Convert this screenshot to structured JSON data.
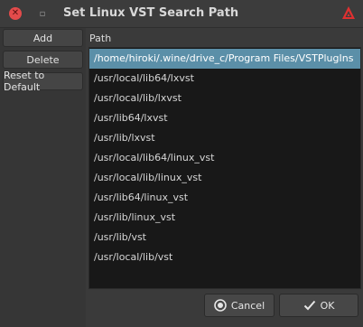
{
  "window": {
    "title": "Set Linux VST Search Path"
  },
  "sidebar": {
    "add_label": "Add",
    "delete_label": "Delete",
    "reset_label": "Reset to Default"
  },
  "list": {
    "header": "Path",
    "items": [
      "/home/hiroki/.wine/drive_c/Program Files/VSTPlugIns",
      "/usr/local/lib64/lxvst",
      "/usr/local/lib/lxvst",
      "/usr/lib64/lxvst",
      "/usr/lib/lxvst",
      "/usr/local/lib64/linux_vst",
      "/usr/local/lib/linux_vst",
      "/usr/lib64/linux_vst",
      "/usr/lib/linux_vst",
      "/usr/lib/vst",
      "/usr/local/lib/vst"
    ],
    "selected_index": 0
  },
  "footer": {
    "cancel_label": "Cancel",
    "ok_label": "OK"
  },
  "icons": {
    "close": "close-icon",
    "minimize": "minimize-icon",
    "logo": "ardour-logo",
    "cancel": "cancel-icon",
    "ok": "checkmark-icon"
  },
  "colors": {
    "selection": "#5b8fa8",
    "close_button": "#e34b4b",
    "logo": "#e03030"
  }
}
